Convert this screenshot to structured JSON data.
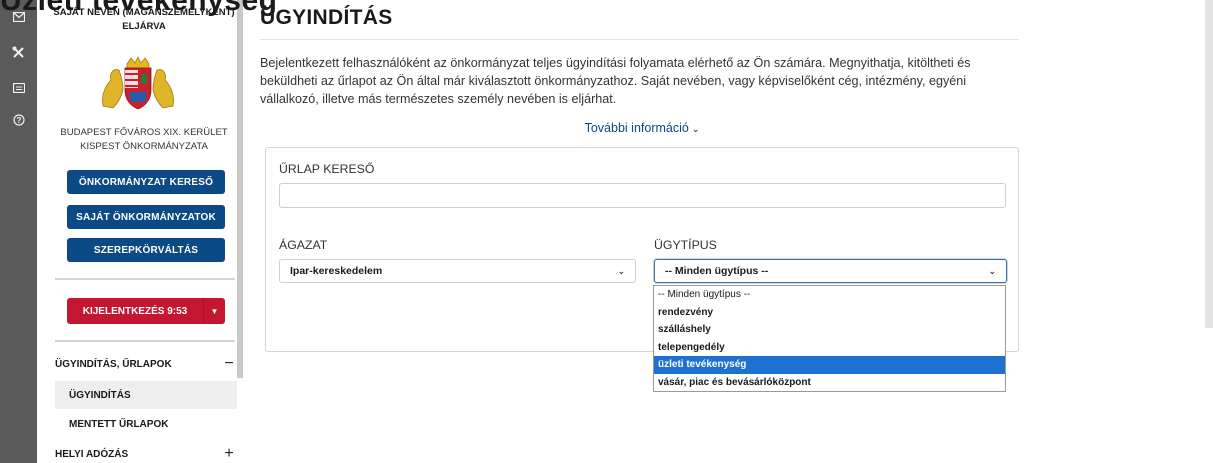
{
  "overlay_title": "Üzleti tevékenység",
  "rail": {
    "icons": [
      "envelope-icon",
      "tools-icon",
      "id-card-icon",
      "help-circle-icon"
    ]
  },
  "sidebar": {
    "heading": "SAJÁT NÉVEN (MAGÁNSZEMÉLYKÉNT) ELJÁRVA",
    "municipality": "BUDAPEST FŐVÁROS XIX. KERÜLET KISPEST ÖNKORMÁNYZATA",
    "buttons": [
      "ÖNKORMÁNYZAT KERESŐ",
      "SAJÁT ÖNKORMÁNYZATOK",
      "SZEREPKÖRVÁLTÁS"
    ],
    "logout_label": "KIJELENTKEZÉS 9:53",
    "menu": {
      "section1": "ÜGYINDÍTÁS, ŰRLAPOK",
      "section1_sign": "−",
      "item_active": "ÜGYINDÍTÁS",
      "item2": "MENTETT ŰRLAPOK",
      "section2": "HELYI ADÓZÁS",
      "section2_sign": "+"
    }
  },
  "main": {
    "title": "ÜGYINDÍTÁS",
    "intro": "Bejelentkezett felhasználóként az önkormányzat teljes ügyindítási folyamata elérhető az Ön számára. Megnyithatja, kitöltheti és beküldheti az űrlapot az Ön által már kiválasztott önkormányzathoz. Saját nevében, vagy képviselőként cég, intézmény, egyéni vállalkozó, illetve más természetes személy nevében is eljárhat.",
    "more_info": "További információ",
    "form": {
      "search_label": "ŰRLAP KERESŐ",
      "search_value": "",
      "sector_label": "ÁGAZAT",
      "sector_value": "Ipar-kereskedelem",
      "type_label": "ÜGYTÍPUS",
      "type_value": "-- Minden ügytípus --"
    },
    "type_options": [
      "-- Minden ügytípus --",
      "rendezvény",
      "szálláshely",
      "telepengedély",
      "üzleti tevékenység",
      "vásár, piac és bevásárlóközpont"
    ],
    "highlighted_option": "üzleti tevékenység"
  },
  "colors": {
    "brand_blue": "#0c4a86",
    "logout_red": "#c21631",
    "highlight": "#1e70d2",
    "rail": "#5a5a5a"
  }
}
